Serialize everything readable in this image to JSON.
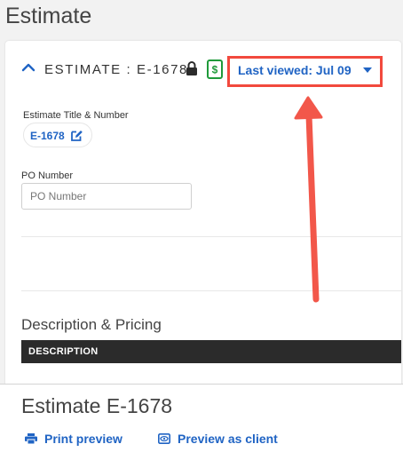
{
  "page": {
    "title": "Estimate"
  },
  "estimate_card": {
    "header_label": "ESTIMATE : E-1678",
    "last_viewed": "Last viewed: Jul 09",
    "icons": [
      "chevron-up-icon",
      "lock-icon",
      "dollar-bill-icon",
      "caret-down-icon"
    ],
    "accent_color": "#2064c4",
    "highlight_color": "#f2493d"
  },
  "fields": {
    "title_number_label": "Estimate Title & Number",
    "title_number_value": "E-1678",
    "po_label": "PO Number",
    "po_placeholder": "PO Number"
  },
  "pricing": {
    "section_title": "Description & Pricing",
    "columns": [
      "DESCRIPTION"
    ]
  },
  "footer": {
    "title": "Estimate E-1678",
    "actions": [
      {
        "label": "Print preview",
        "icon": "printer-icon"
      },
      {
        "label": "Preview as client",
        "icon": "eye-icon"
      }
    ]
  }
}
